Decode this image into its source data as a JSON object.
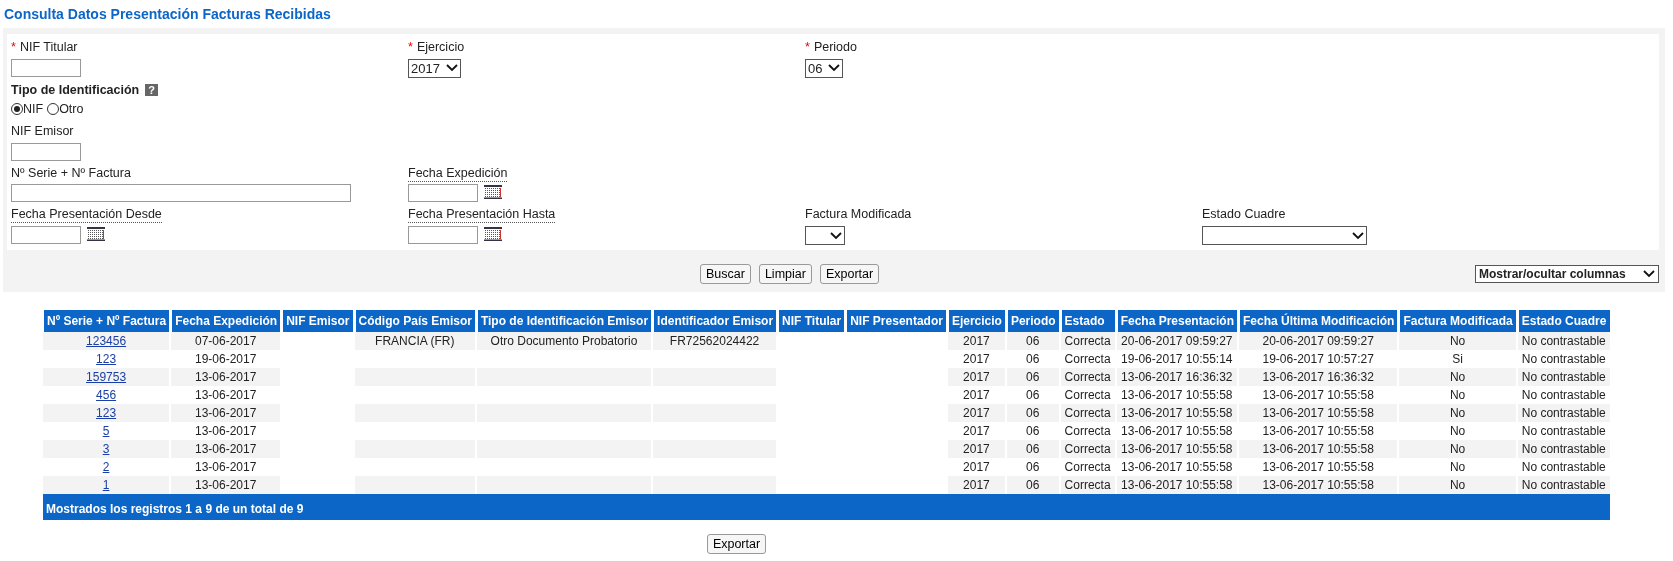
{
  "title": "Consulta Datos Presentación Facturas Recibidas",
  "form": {
    "rows": [
      [
        {
          "kind": "text",
          "label": "NIF Titular",
          "marker": "*"
        },
        {
          "kind": "select",
          "label": "Ejercicio",
          "marker": "*",
          "value": "2017"
        },
        {
          "kind": "select",
          "label": "Periodo",
          "marker": "*",
          "value": "06"
        }
      ],
      [
        {
          "kind": "radio",
          "label": "Tipo de Identificación",
          "help": "?",
          "options": [
            {
              "label": "NIF",
              "selected": true
            },
            {
              "label": "Otro",
              "selected": false
            }
          ]
        }
      ],
      [
        {
          "kind": "text",
          "label": "NIF Emisor"
        }
      ],
      [
        {
          "kind": "wide",
          "label": "Nº Serie + Nº Factura"
        },
        {
          "kind": "date",
          "label": "Fecha Expedición"
        }
      ],
      [
        {
          "kind": "date",
          "label": "Fecha Presentación Desde"
        },
        {
          "kind": "date",
          "label": "Fecha Presentación Hasta"
        },
        {
          "kind": "select",
          "label": "Factura Modificada"
        },
        {
          "kind": "wideselect",
          "label": "Estado Cuadre"
        }
      ]
    ],
    "buttons": [
      "Buscar",
      "Limpiar",
      "Exportar"
    ],
    "columns_menu": "Mostrar/ocultar columnas"
  },
  "table": {
    "columns": [
      "Nº Serie + Nº Factura",
      "Fecha Expedición",
      "NIF Emisor",
      "Código País Emisor",
      "Tipo de Identificación Emisor",
      "Identificador Emisor",
      "NIF Titular",
      "NIF Presentador",
      "Ejercicio",
      "Periodo",
      "Estado",
      "Fecha Presentación",
      "Fecha Última Modificación",
      "Factura Modificada",
      "Estado Cuadre"
    ],
    "rows": [
      [
        "123456",
        "07-06-2017",
        "",
        "FRANCIA (FR)",
        "Otro Documento Probatorio",
        "FR72562024422",
        "",
        "",
        "2017",
        "06",
        "Correcta",
        "20-06-2017 09:59:27",
        "20-06-2017 09:59:27",
        "No",
        "No contrastable"
      ],
      [
        "123",
        "19-06-2017",
        "",
        "",
        "",
        "",
        "",
        "",
        "2017",
        "06",
        "Correcta",
        "19-06-2017 10:55:14",
        "19-06-2017 10:57:27",
        "Si",
        "No contrastable"
      ],
      [
        "159753",
        "13-06-2017",
        "",
        "",
        "",
        "",
        "",
        "",
        "2017",
        "06",
        "Correcta",
        "13-06-2017 16:36:32",
        "13-06-2017 16:36:32",
        "No",
        "No contrastable"
      ],
      [
        "456",
        "13-06-2017",
        "",
        "",
        "",
        "",
        "",
        "",
        "2017",
        "06",
        "Correcta",
        "13-06-2017 10:55:58",
        "13-06-2017 10:55:58",
        "No",
        "No contrastable"
      ],
      [
        "123",
        "13-06-2017",
        "",
        "",
        "",
        "",
        "",
        "",
        "2017",
        "06",
        "Correcta",
        "13-06-2017 10:55:58",
        "13-06-2017 10:55:58",
        "No",
        "No contrastable"
      ],
      [
        "5",
        "13-06-2017",
        "",
        "",
        "",
        "",
        "",
        "",
        "2017",
        "06",
        "Correcta",
        "13-06-2017 10:55:58",
        "13-06-2017 10:55:58",
        "No",
        "No contrastable"
      ],
      [
        "3",
        "13-06-2017",
        "",
        "",
        "",
        "",
        "",
        "",
        "2017",
        "06",
        "Correcta",
        "13-06-2017 10:55:58",
        "13-06-2017 10:55:58",
        "No",
        "No contrastable"
      ],
      [
        "2",
        "13-06-2017",
        "",
        "",
        "",
        "",
        "",
        "",
        "2017",
        "06",
        "Correcta",
        "13-06-2017 10:55:58",
        "13-06-2017 10:55:58",
        "No",
        "No contrastable"
      ],
      [
        "1",
        "13-06-2017",
        "",
        "",
        "",
        "",
        "",
        "",
        "2017",
        "06",
        "Correcta",
        "13-06-2017 10:55:58",
        "13-06-2017 10:55:58",
        "No",
        "No contrastable"
      ]
    ],
    "footer": "Mostrados los registros 1 a 9 de un total de 9"
  },
  "export_button": "Exportar"
}
